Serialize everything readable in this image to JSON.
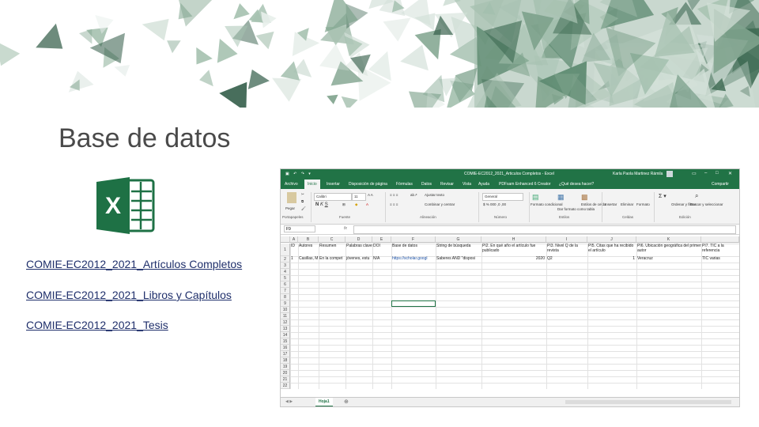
{
  "slide": {
    "title": "Base de datos",
    "links": [
      "COMIE-EC2012_2021_Artículos Completos",
      "COMIE-EC2012_2021_Libros y Capítulos",
      "COMIE-EC2012_2021_Tesis"
    ],
    "accent_color": "#5f8b72"
  },
  "excel": {
    "window_title": "COMIE-EC2012_2021_Articulos Completos - Excel",
    "user_name": "Karla Paola Martinez Rámila",
    "ribbon_tabs": [
      "Archivo",
      "Inicio",
      "Insertar",
      "Disposición de página",
      "Fórmulas",
      "Datos",
      "Revisar",
      "Vista",
      "Ayuda",
      "PDFsam Enhanced 6 Creator",
      "¿Qué desea hacer?",
      "Compartir"
    ],
    "active_tab": "Inicio",
    "groups": [
      "Portapapeles",
      "Fuente",
      "Alineación",
      "Número",
      "Estilos",
      "Celdas",
      "Edición"
    ],
    "font_name": "Calibri",
    "font_size": "11",
    "wrap_text": "Ajustar texto",
    "merge_center": "Combinar y centrar",
    "number_format": "General",
    "styles_buttons": [
      "Formato condicional",
      "Dar formato como tabla",
      "Estilos de celda"
    ],
    "cells_buttons": [
      "Insertar",
      "Eliminar",
      "Formato"
    ],
    "editing_buttons": [
      "Ordenar y filtrar",
      "Buscar y seleccionar"
    ],
    "paste_label": "Pegar",
    "name_box": "F9",
    "fx_label": "fx",
    "columns": [
      "A",
      "B",
      "C",
      "D",
      "E",
      "F",
      "G",
      "H",
      "I",
      "J",
      "K"
    ],
    "header_row": [
      "ID",
      "Autores",
      "Resumen",
      "Palabras clave",
      "DOI",
      "Base de datos",
      "String de búsqueda",
      "PI2. En qué año el artículo fue publicado",
      "PI3. Nivel Q de la revista",
      "PI5. Citas que ha recibido el artículo",
      "PI6. Ubicación geográfica del primer autor",
      "PI7. TIC a la referencia"
    ],
    "data_row": [
      "1",
      "Casillas, M.",
      "En la compet",
      "jóvenes, estu",
      "N/A",
      "https://scholar.googl",
      "Saberes AND \"disposi",
      "2020",
      "Q2",
      "1",
      "Veracruz",
      "TIC varias"
    ],
    "row_numbers": [
      "1",
      "2",
      "3",
      "4",
      "5",
      "6",
      "7",
      "8",
      "9",
      "10",
      "11",
      "12",
      "13",
      "14",
      "15",
      "16",
      "17",
      "18",
      "19",
      "20",
      "21",
      "22"
    ],
    "sheet_tab": "Hoja1"
  }
}
